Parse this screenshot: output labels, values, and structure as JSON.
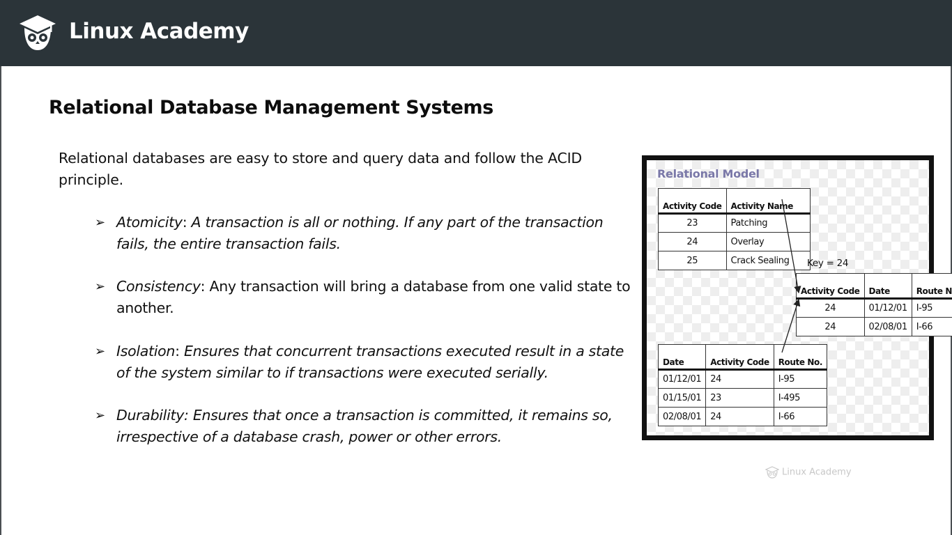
{
  "header": {
    "brand": "Linux Academy",
    "logo_icon": "owl-graduation-cap-icon",
    "background": "#2b3439"
  },
  "slide": {
    "title": "Relational Database Management Systems",
    "intro": "Relational databases are easy to store and query data and follow the ACID principle.",
    "bullets": [
      {
        "term": "Atomicity",
        "sep": ": ",
        "desc": "A transaction is all or nothing. If any part of the transaction fails, the entire transaction fails."
      },
      {
        "term": "Consistency",
        "sep": ": ",
        "desc": "Any transaction will bring a database from one valid state to another."
      },
      {
        "term": "Isolation",
        "sep": ": ",
        "desc": "Ensures that concurrent transactions executed result in a state of the system similar to if transactions were executed serially."
      },
      {
        "term": "Durability:",
        "sep": " ",
        "desc": "Ensures that once a transaction is committed, it remains so, irrespective of a database crash, power or other errors."
      }
    ],
    "bullet_glyph": "➢"
  },
  "diagram": {
    "title": "Relational Model",
    "key_label": "Key = 24",
    "activity_table": {
      "headers": [
        "Activity Code",
        "Activity Name"
      ],
      "rows": [
        [
          "23",
          "Patching"
        ],
        [
          "24",
          "Overlay"
        ],
        [
          "25",
          "Crack Sealing"
        ]
      ]
    },
    "result_table": {
      "headers": [
        "Activity Code",
        "Date",
        "Route No."
      ],
      "rows": [
        [
          "24",
          "01/12/01",
          "I-95"
        ],
        [
          "24",
          "02/08/01",
          "I-66"
        ]
      ]
    },
    "work_table": {
      "headers": [
        "Date",
        "Activity Code",
        "Route No."
      ],
      "rows": [
        [
          "01/12/01",
          "24",
          "I-95"
        ],
        [
          "01/15/01",
          "23",
          "I-495"
        ],
        [
          "02/08/01",
          "24",
          "I-66"
        ]
      ]
    }
  },
  "watermark": {
    "text": "Linux Academy"
  }
}
